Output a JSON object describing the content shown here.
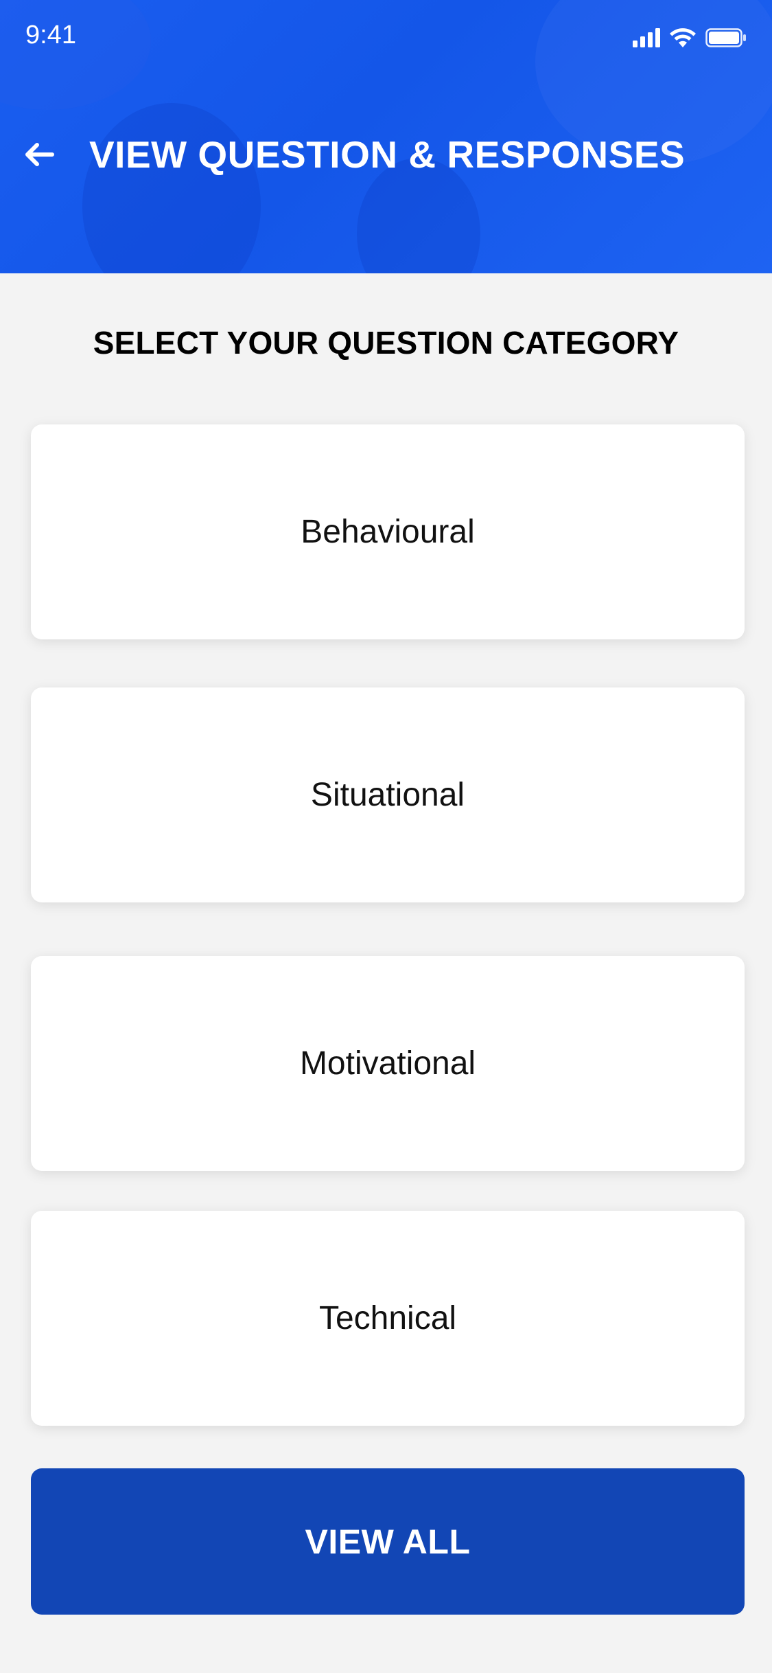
{
  "status_bar": {
    "time": "9:41"
  },
  "header": {
    "title": "VIEW QUESTION & RESPONSES"
  },
  "section": {
    "title": "SELECT YOUR QUESTION CATEGORY"
  },
  "categories": [
    {
      "label": "Behavioural"
    },
    {
      "label": "Situational"
    },
    {
      "label": "Motivational"
    },
    {
      "label": "Technical"
    }
  ],
  "actions": {
    "view_all_label": "VIEW ALL"
  },
  "icons": {
    "back": "arrow-left-icon",
    "signal": "cellular-signal-icon",
    "wifi": "wifi-icon",
    "battery": "battery-icon"
  },
  "colors": {
    "header_blue": "#1a5ef0",
    "button_blue": "#1246b5",
    "background": "#f3f3f3",
    "card": "#ffffff"
  }
}
